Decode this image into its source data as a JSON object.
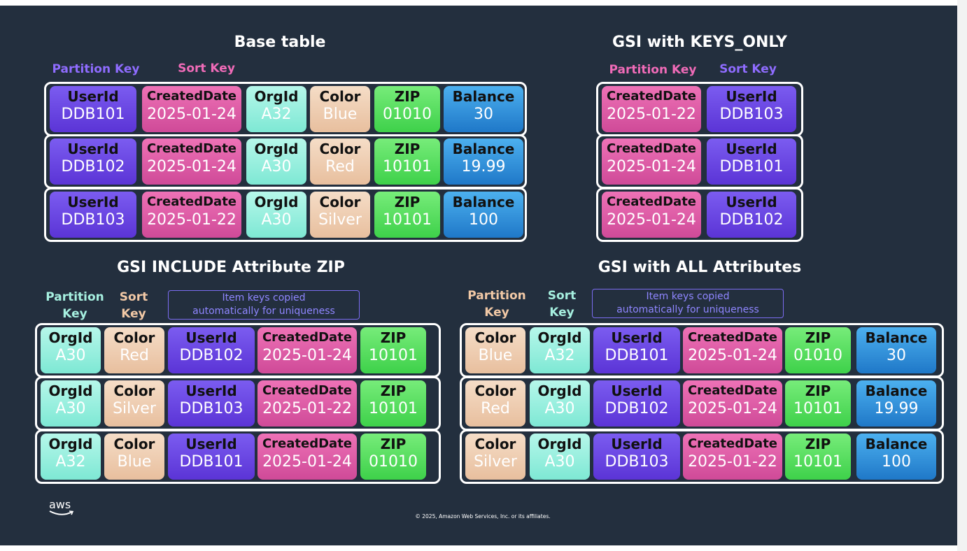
{
  "titles": {
    "base": "Base table",
    "keys_only": "GSI with KEYS_ONLY",
    "include": "GSI INCLUDE Attribute ZIP",
    "all": "GSI with ALL Attributes"
  },
  "labels": {
    "base_pk": "Partition Key",
    "base_sk": "Sort Key",
    "keys_pk": "Partition Key",
    "keys_sk": "Sort Key",
    "inc_pk_1": "Partition",
    "inc_pk_2": "Key",
    "inc_sk_1": "Sort",
    "inc_sk_2": "Key",
    "inc_note_1": "Item keys copied",
    "inc_note_2": "automatically for uniqueness",
    "all_pk_1": "Partition",
    "all_pk_2": "Key",
    "all_sk_1": "Sort",
    "all_sk_2": "Key",
    "all_note_1": "Item keys copied",
    "all_note_2": "automatically for uniqueness"
  },
  "colors": {
    "pk_purple": "#8f6cff",
    "sk_pink": "#f06bb8",
    "pk_mint": "#a6f0e0",
    "sk_peach": "#f2c9a6",
    "background": "#232f3e"
  },
  "base_table": [
    {
      "userid": "UserId",
      "userid_v": "DDB101",
      "date": "CreatedDate",
      "date_v": "2025-01-24",
      "org": "OrgId",
      "org_v": "A32",
      "color": "Color",
      "color_v": "Blue",
      "zip": "ZIP",
      "zip_v": "01010",
      "bal": "Balance",
      "bal_v": "30"
    },
    {
      "userid": "UserId",
      "userid_v": "DDB102",
      "date": "CreatedDate",
      "date_v": "2025-01-24",
      "org": "OrgId",
      "org_v": "A30",
      "color": "Color",
      "color_v": "Red",
      "zip": "ZIP",
      "zip_v": "10101",
      "bal": "Balance",
      "bal_v": "19.99"
    },
    {
      "userid": "UserId",
      "userid_v": "DDB103",
      "date": "CreatedDate",
      "date_v": "2025-01-22",
      "org": "OrgId",
      "org_v": "A30",
      "color": "Color",
      "color_v": "Silver",
      "zip": "ZIP",
      "zip_v": "10101",
      "bal": "Balance",
      "bal_v": "100"
    }
  ],
  "keys_only": [
    {
      "date": "CreatedDate",
      "date_v": "2025-01-22",
      "userid": "UserId",
      "userid_v": "DDB103"
    },
    {
      "date": "CreatedDate",
      "date_v": "2025-01-24",
      "userid": "UserId",
      "userid_v": "DDB101"
    },
    {
      "date": "CreatedDate",
      "date_v": "2025-01-24",
      "userid": "UserId",
      "userid_v": "DDB102"
    }
  ],
  "include": [
    {
      "org": "OrgId",
      "org_v": "A30",
      "color": "Color",
      "color_v": "Red",
      "userid": "UserId",
      "userid_v": "DDB102",
      "date": "CreatedDate",
      "date_v": "2025-01-24",
      "zip": "ZIP",
      "zip_v": "10101"
    },
    {
      "org": "OrgId",
      "org_v": "A30",
      "color": "Color",
      "color_v": "Silver",
      "userid": "UserId",
      "userid_v": "DDB103",
      "date": "CreatedDate",
      "date_v": "2025-01-22",
      "zip": "ZIP",
      "zip_v": "10101"
    },
    {
      "org": "OrgId",
      "org_v": "A32",
      "color": "Color",
      "color_v": "Blue",
      "userid": "UserId",
      "userid_v": "DDB101",
      "date": "CreatedDate",
      "date_v": "2025-01-24",
      "zip": "ZIP",
      "zip_v": "01010"
    }
  ],
  "all_attrs": [
    {
      "color": "Color",
      "color_v": "Blue",
      "org": "OrgId",
      "org_v": "A32",
      "userid": "UserId",
      "userid_v": "DDB101",
      "date": "CreatedDate",
      "date_v": "2025-01-24",
      "zip": "ZIP",
      "zip_v": "01010",
      "bal": "Balance",
      "bal_v": "30"
    },
    {
      "color": "Color",
      "color_v": "Red",
      "org": "OrgId",
      "org_v": "A30",
      "userid": "UserId",
      "userid_v": "DDB102",
      "date": "CreatedDate",
      "date_v": "2025-01-24",
      "zip": "ZIP",
      "zip_v": "10101",
      "bal": "Balance",
      "bal_v": "19.99"
    },
    {
      "color": "Color",
      "color_v": "Silver",
      "org": "OrgId",
      "org_v": "A30",
      "userid": "UserId",
      "userid_v": "DDB103",
      "date": "CreatedDate",
      "date_v": "2025-01-22",
      "zip": "ZIP",
      "zip_v": "10101",
      "bal": "Balance",
      "bal_v": "100"
    }
  ],
  "footer": {
    "logo": "aws",
    "copyright": "© 2025, Amazon Web Services, Inc. or its affiliates."
  }
}
